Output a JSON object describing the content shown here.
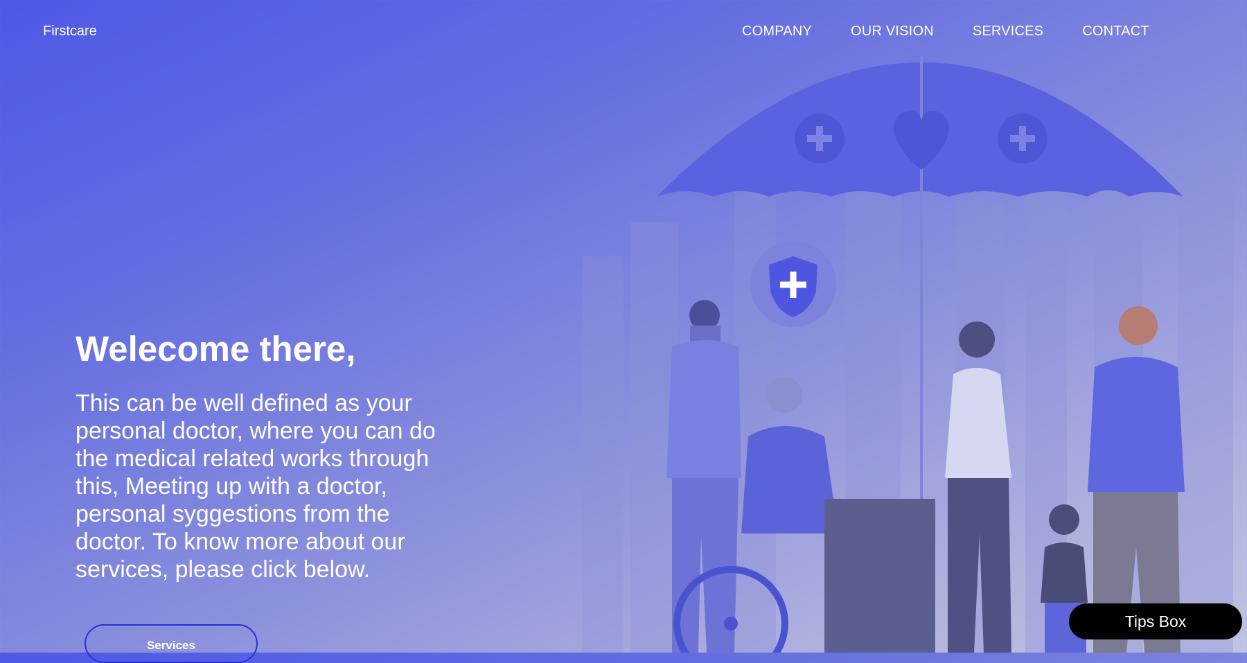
{
  "header": {
    "brand": "Firstcare",
    "nav": [
      {
        "label": "COMPANY"
      },
      {
        "label": "OUR VISION"
      },
      {
        "label": "SERVICES"
      },
      {
        "label": "CONTACT"
      }
    ]
  },
  "hero": {
    "title": "Welecome there,",
    "text": "This can be well defined as your personal doctor, where you can do the medical related works through this, Meeting up with a doctor, personal syggestions from the doctor. To know more about our services, please click below.",
    "button_label": "Services"
  },
  "tips_box": {
    "label": "Tips Box"
  },
  "colors": {
    "gradient_start": "#4f58e6",
    "gradient_end": "#c1c3e2",
    "accent_border": "#2a31d8",
    "tips_background": "#000000"
  }
}
